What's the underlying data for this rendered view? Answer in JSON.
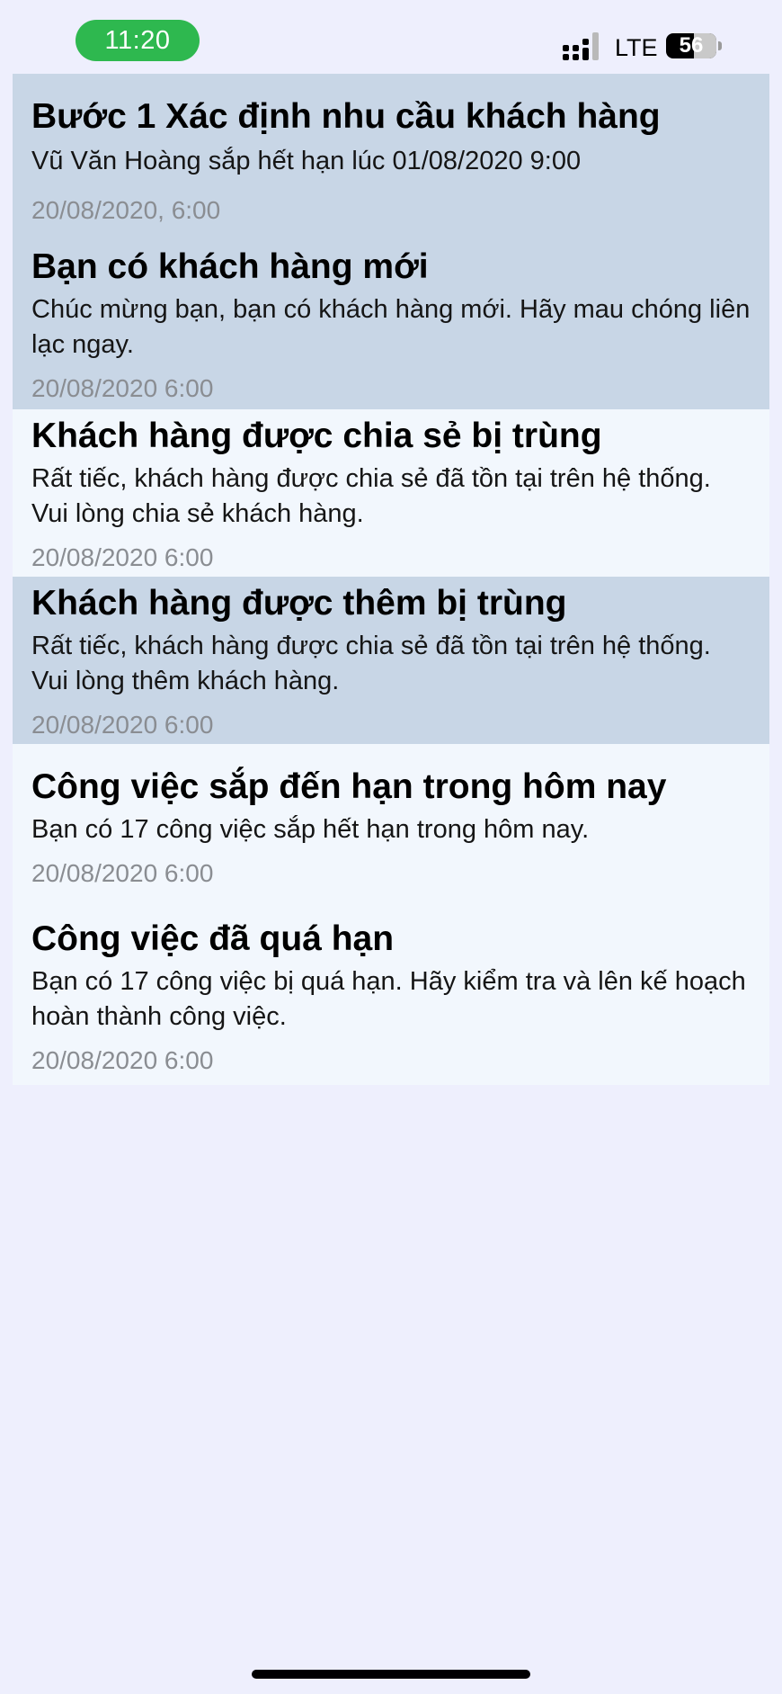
{
  "status_bar": {
    "time": "11:20",
    "network": "LTE",
    "battery": "56",
    "battery_level": 0.56,
    "colors": {
      "time_pill": "#2eb84f"
    }
  },
  "notifications": [
    {
      "title": "Bước 1 Xác định nhu cầu khách hàng",
      "body": "Vũ Văn Hoàng sắp hết hạn lúc 01/08/2020 9:00",
      "time": "20/08/2020, 6:00",
      "unread": true
    },
    {
      "title": "Bạn có khách hàng mới",
      "body": "Chúc mừng bạn, bạn có khách hàng mới. Hãy mau chóng liên lạc ngay.",
      "time": "20/08/2020 6:00",
      "unread": true
    },
    {
      "title": "Khách hàng được chia sẻ bị trùng",
      "body": "Rất tiếc, khách hàng được chia sẻ đã tồn tại trên hệ thống. Vui lòng chia sẻ khách hàng.",
      "time": "20/08/2020 6:00",
      "unread": false
    },
    {
      "title": "Khách hàng được thêm bị trùng",
      "body": "Rất tiếc, khách hàng được chia sẻ đã tồn tại trên hệ thống. Vui lòng thêm khách hàng.",
      "time": "20/08/2020 6:00",
      "unread": true
    },
    {
      "title": "Công việc sắp đến hạn trong hôm nay",
      "body": "Bạn có 17 công việc sắp hết hạn trong hôm nay.",
      "time": "20/08/2020 6:00",
      "unread": false
    },
    {
      "title": "Công việc đã quá hạn",
      "body": "Bạn có 17 công việc bị quá hạn. Hãy kiểm tra và lên kế hoạch hoàn thành công việc.",
      "time": "20/08/2020 6:00",
      "unread": false
    }
  ],
  "colors": {
    "background": "#eeeffd",
    "unread_row": "#c8d6e6",
    "read_row": "#f2f7fd",
    "timestamp": "#8a8d92"
  }
}
